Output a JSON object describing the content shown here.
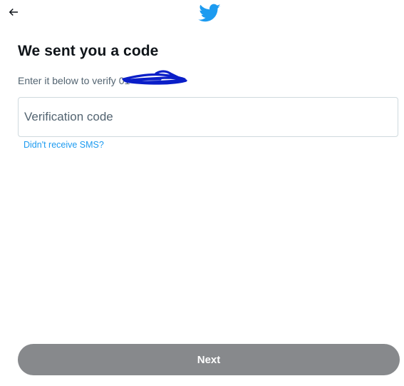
{
  "header": {
    "back_icon": "arrow-left-icon",
    "logo_icon": "twitter-bird-icon",
    "brand_color": "#1d9bf0"
  },
  "main": {
    "title": "We sent you a code",
    "subtitle_prefix": "Enter it below to verify",
    "phone_visible": "01",
    "code_input": {
      "placeholder": "Verification code",
      "value": ""
    },
    "help_link": "Didn't receive SMS?"
  },
  "footer": {
    "next_label": "Next",
    "next_button_color": "#87898c"
  }
}
